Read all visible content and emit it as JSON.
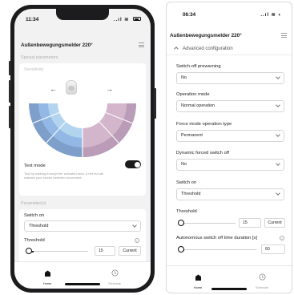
{
  "left_phone": {
    "status": {
      "time": "11:34",
      "icons": "..ıl ≋"
    },
    "header": {
      "title": "Außenbewegungsmelder 220°"
    },
    "special_parameters_label": "Special parameters",
    "sensitivity": {
      "label": "Sensitivity",
      "arrow_left": "←",
      "arrow_right": "→",
      "colors": [
        "#7d9fc9",
        "#93b8e6",
        "#b3d4ef",
        "#d5b8cc",
        "#c69bb5"
      ]
    },
    "test_mode": {
      "label": "Test mode",
      "enabled": true,
      "description": "Test by walking through the activated area. A red ind will indicate your shows detected movement."
    },
    "parameters_label": "Parameter(s)",
    "switch_on": {
      "label": "Switch on",
      "value": "Threshold"
    },
    "threshold": {
      "label": "Threshold",
      "value": "15",
      "current_button": "Current",
      "slider_position": 0.05
    },
    "tabs": [
      {
        "label": "Home",
        "icon": "home-icon",
        "active": true
      },
      {
        "label": "Schedule",
        "icon": "clock-icon",
        "active": false
      }
    ]
  },
  "right_phone": {
    "status": {
      "time": "06:34",
      "icons": "..ıl ≋ ◐"
    },
    "header": {
      "title": "Außenbewegungsmelder 220°"
    },
    "advanced_configuration_label": "Advanced configuration",
    "fields": [
      {
        "label": "Switch-off prewarning",
        "value": "No"
      },
      {
        "label": "Operation mode",
        "value": "Normal operation"
      },
      {
        "label": "Force mode operation type",
        "value": "Permanent"
      },
      {
        "label": "Dynamic forced switch off",
        "value": "No"
      },
      {
        "label": "Switch on",
        "value": "Threshold"
      }
    ],
    "threshold": {
      "label": "Threshold",
      "value": "15",
      "current_button": "Current",
      "slider_position": 0.05
    },
    "auto_off": {
      "label": "Autonomous switch off time duration [s]",
      "value": "60",
      "slider_position": 0.05
    },
    "tabs": [
      {
        "label": "Home",
        "icon": "home-icon",
        "active": true
      },
      {
        "label": "Schedule",
        "icon": "clock-icon",
        "active": false
      }
    ]
  }
}
